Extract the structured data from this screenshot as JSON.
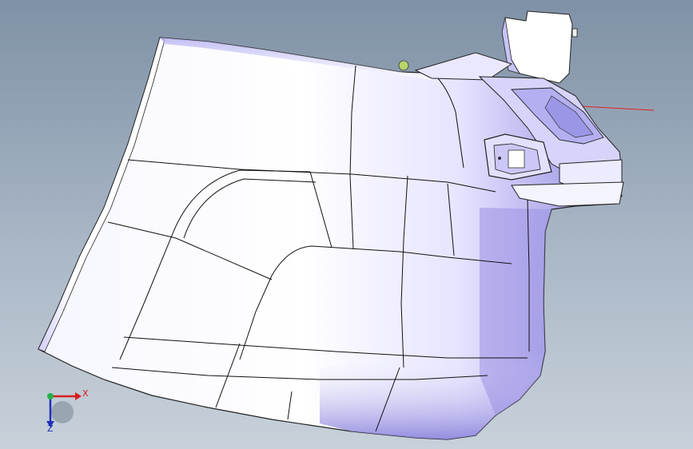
{
  "viewport": {
    "background_top": "#7f91a6",
    "background_bottom": "#c8d1da"
  },
  "model": {
    "face_color": "#ffffff",
    "shade_color": "#8f86e0",
    "edge_color": "#111111",
    "reference_axis_color": "#e02020"
  },
  "triad": {
    "x_label": "X",
    "z_label": "Z",
    "x_color": "#d81e1e",
    "y_color": "#21b24a",
    "z_color": "#1e2fb8"
  }
}
